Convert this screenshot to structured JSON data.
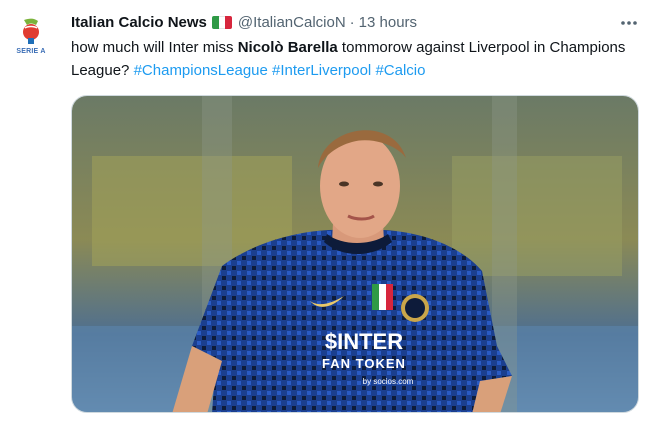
{
  "tweet": {
    "display_name": "Italian Calcio News",
    "handle": "@ItalianCalcioN",
    "separator": "·",
    "time": "13 hours",
    "avatar_label": "SERIE A",
    "avatar_icon": "serie-a-logo",
    "flag_icon": "italy-flag",
    "more_icon": "more-horizontal-icon",
    "text_before": "how much will Inter miss ",
    "text_bold": "Nicolò Barella",
    "text_after": " tommorow against Liverpool in Champions League?  ",
    "hashtags": [
      "#ChampionsLeague",
      "#InterLiverpool",
      "#Calcio"
    ],
    "photo": {
      "sponsor_line1": "$INTER",
      "sponsor_line2": "FAN TOKEN",
      "sponsor_line3": "by socios.com"
    }
  },
  "colors": {
    "link": "#1d9bf0",
    "secondary_text": "#536471",
    "jersey_blue": "#1b3f8f",
    "jersey_dark": "#0d1b3a"
  }
}
